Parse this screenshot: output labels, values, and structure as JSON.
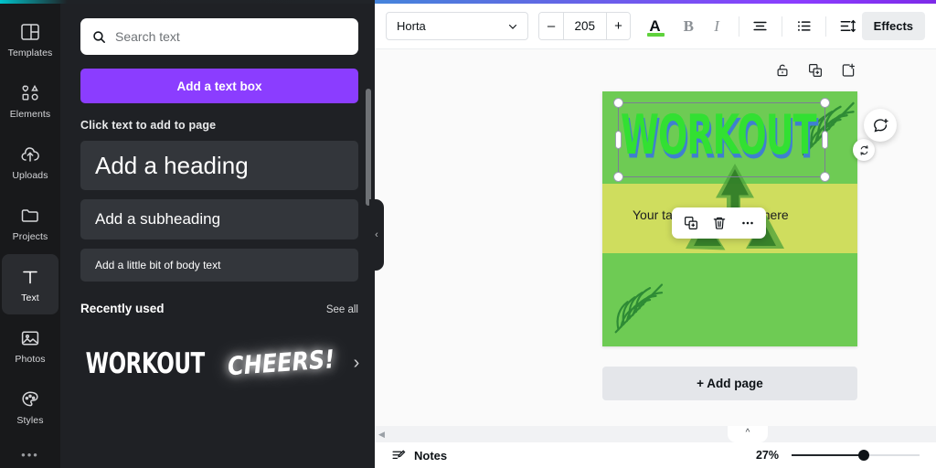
{
  "brand": {
    "gradient_start": "#00c4cc",
    "gradient_end": "#7d2ae8",
    "accent_purple": "#8b3dff"
  },
  "sidebar": {
    "items": [
      {
        "label": "Templates",
        "icon": "templates-icon",
        "active": false
      },
      {
        "label": "Elements",
        "icon": "elements-icon",
        "active": false
      },
      {
        "label": "Uploads",
        "icon": "uploads-icon",
        "active": false
      },
      {
        "label": "Projects",
        "icon": "projects-icon",
        "active": false
      },
      {
        "label": "Text",
        "icon": "text-icon",
        "active": true
      },
      {
        "label": "Photos",
        "icon": "photos-icon",
        "active": false
      },
      {
        "label": "Styles",
        "icon": "styles-icon",
        "active": false
      }
    ],
    "more_label": "•••"
  },
  "panel": {
    "search": {
      "placeholder": "Search text",
      "value": "",
      "icon": "search-icon"
    },
    "add_text_box_label": "Add a text box",
    "section_hint": "Click text to add to page",
    "presets": [
      {
        "label": "Add a heading",
        "style": "heading"
      },
      {
        "label": "Add a subheading",
        "style": "subheading"
      },
      {
        "label": "Add a little bit of body text",
        "style": "body"
      }
    ],
    "recently_used": {
      "title": "Recently used",
      "see_all_label": "See all",
      "thumbs": [
        {
          "label": "WORKOUT",
          "style": "condensed-bold"
        },
        {
          "label": "CHEERS!",
          "style": "italic-glow"
        }
      ],
      "next_icon": "chevron-right-icon"
    },
    "collapse_icon": "chevron-left-icon"
  },
  "toolbar": {
    "font_family": "Horta",
    "font_dropdown_icon": "chevron-down-icon",
    "font_size": "205",
    "decrease_label": "–",
    "increase_label": "+",
    "text_color_letter": "A",
    "text_color": "#5fd23c",
    "bold_label": "B",
    "italic_label": "I",
    "align_icon": "align-center-icon",
    "list_icon": "bullet-list-icon",
    "spacing_icon": "line-spacing-icon",
    "effects_label": "Effects"
  },
  "canvas": {
    "page_tools": [
      {
        "icon": "lock-icon",
        "name": "lock"
      },
      {
        "icon": "duplicate-icon",
        "name": "duplicate"
      },
      {
        "icon": "add-page-icon",
        "name": "add-page"
      }
    ],
    "design": {
      "background_color": "#6ecb54",
      "band_color": "#cfdd5e",
      "heading_text": "WORKOUT",
      "heading_color": "#32e032",
      "heading_shadow_color": "#3f7fd0",
      "subheading_text": "Your tagline goes right here",
      "decorations": [
        "palm-leaf",
        "recycle-symbol"
      ]
    },
    "context_toolbar": [
      {
        "icon": "duplicate-icon",
        "name": "duplicate"
      },
      {
        "icon": "trash-icon",
        "name": "delete"
      },
      {
        "icon": "more-icon",
        "name": "more-options"
      }
    ],
    "rotate_icon": "rotate-icon",
    "comment_icon": "add-comment-icon",
    "add_page_label": "+ Add page"
  },
  "statusbar": {
    "notes_label": "Notes",
    "notes_icon": "notes-icon",
    "zoom_percent": "27%",
    "expand_icon": "chevron-up-icon",
    "scroll_left_icon": "chevron-left-small-icon"
  }
}
